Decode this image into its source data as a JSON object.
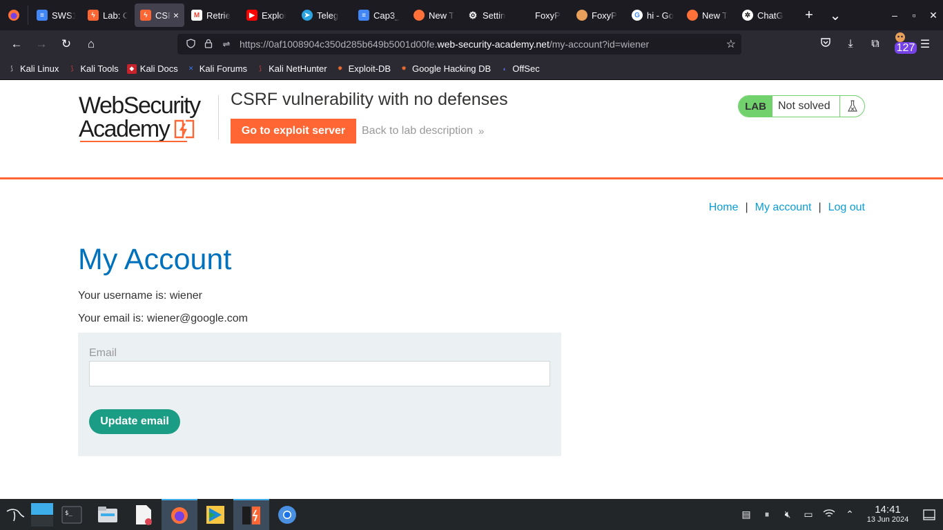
{
  "browser": {
    "tabs": [
      {
        "title": "SWS1(",
        "icon": "google-docs-icon",
        "color": "#4285f4"
      },
      {
        "title": "Lab: C",
        "icon": "portswigger-icon",
        "color": "#ff6633"
      },
      {
        "title": "CSR",
        "icon": "portswigger-icon",
        "color": "#ff6633",
        "active": true
      },
      {
        "title": "Retrie",
        "icon": "gmail-icon",
        "color": "#ea4335"
      },
      {
        "title": "Exploi",
        "icon": "youtube-icon",
        "color": "#ff0000"
      },
      {
        "title": "Teleg",
        "icon": "telegram-icon",
        "color": "#2aa3e0"
      },
      {
        "title": "Cap3_",
        "icon": "google-docs-icon",
        "color": "#4285f4"
      },
      {
        "title": "New T",
        "icon": "firefox-icon",
        "color": "#ff7139"
      },
      {
        "title": "Settin",
        "icon": "gear-icon",
        "color": "#fbfbfe"
      },
      {
        "title": "FoxyP",
        "icon": "blank-icon",
        "color": "transparent"
      },
      {
        "title": "FoxyP",
        "icon": "foxyproxy-icon",
        "color": "#e8a05a"
      },
      {
        "title": "hi - Go",
        "icon": "google-icon",
        "color": "#ffffff"
      },
      {
        "title": "New T",
        "icon": "firefox-icon",
        "color": "#ff7139"
      },
      {
        "title": "ChatG",
        "icon": "chatgpt-icon",
        "color": "#ffffff"
      }
    ],
    "tab_close": "×",
    "new_tab": "+",
    "tab_list": "⌄",
    "window_controls": {
      "minimize": "–",
      "maximize": "▫",
      "close": "✕"
    },
    "nav": {
      "back": "←",
      "forward": "→",
      "reload": "↻",
      "home": "⌂"
    },
    "url": {
      "prefix": "https://0af1008904c350d285b649b5001d00fe.",
      "domain": "web-security-academy.net",
      "path": "/my-account?id=wiener"
    },
    "extensions_badge": "127",
    "bookmarks": [
      {
        "label": "Kali Linux",
        "icon": "kali-dragon-icon",
        "color": "#cfcfd8"
      },
      {
        "label": "Kali Tools",
        "icon": "kali-tools-icon",
        "color": "#e0413c"
      },
      {
        "label": "Kali Docs",
        "icon": "kali-docs-icon",
        "color": "#c5222b"
      },
      {
        "label": "Kali Forums",
        "icon": "kali-forums-icon",
        "color": "#367bf0"
      },
      {
        "label": "Kali NetHunter",
        "icon": "kali-nethunter-icon",
        "color": "#e0413c"
      },
      {
        "label": "Exploit-DB",
        "icon": "exploit-db-icon",
        "color": "#ec6b2d"
      },
      {
        "label": "Google Hacking DB",
        "icon": "ghdb-icon",
        "color": "#ec6b2d"
      },
      {
        "label": "OffSec",
        "icon": "offsec-icon",
        "color": "#5b6cf0"
      }
    ]
  },
  "lab": {
    "logo_line1": "WebSecurity",
    "logo_line2": "Academy",
    "title": "CSRF vulnerability with no defenses",
    "exploit_button": "Go to exploit server",
    "back_link": "Back to lab description",
    "back_chevrons": "»",
    "status_tag": "LAB",
    "status_text": "Not solved",
    "accent_color": "#ff6633",
    "status_color": "#70d16d"
  },
  "site_nav": {
    "home": "Home",
    "my_account": "My account",
    "log_out": "Log out",
    "separator": "|"
  },
  "account": {
    "heading": "My Account",
    "username_line": "Your username is: wiener",
    "email_line": "Your email is: wiener@google.com",
    "email_label": "Email",
    "email_value": "",
    "update_button": "Update email",
    "heading_color": "#0071bc",
    "button_color": "#1b9c85"
  },
  "taskbar": {
    "items": [
      {
        "name": "kali-menu-icon"
      },
      {
        "name": "workspace-switcher-icon"
      },
      {
        "name": "terminal-icon"
      },
      {
        "name": "file-manager-icon"
      },
      {
        "name": "text-editor-icon"
      },
      {
        "name": "firefox-taskbar-icon",
        "active": true
      },
      {
        "name": "burp-launcher-icon"
      },
      {
        "name": "burp-suite-icon",
        "active": true
      },
      {
        "name": "chromium-icon"
      }
    ],
    "time": "14:41",
    "date": "13 Jun 2024"
  }
}
